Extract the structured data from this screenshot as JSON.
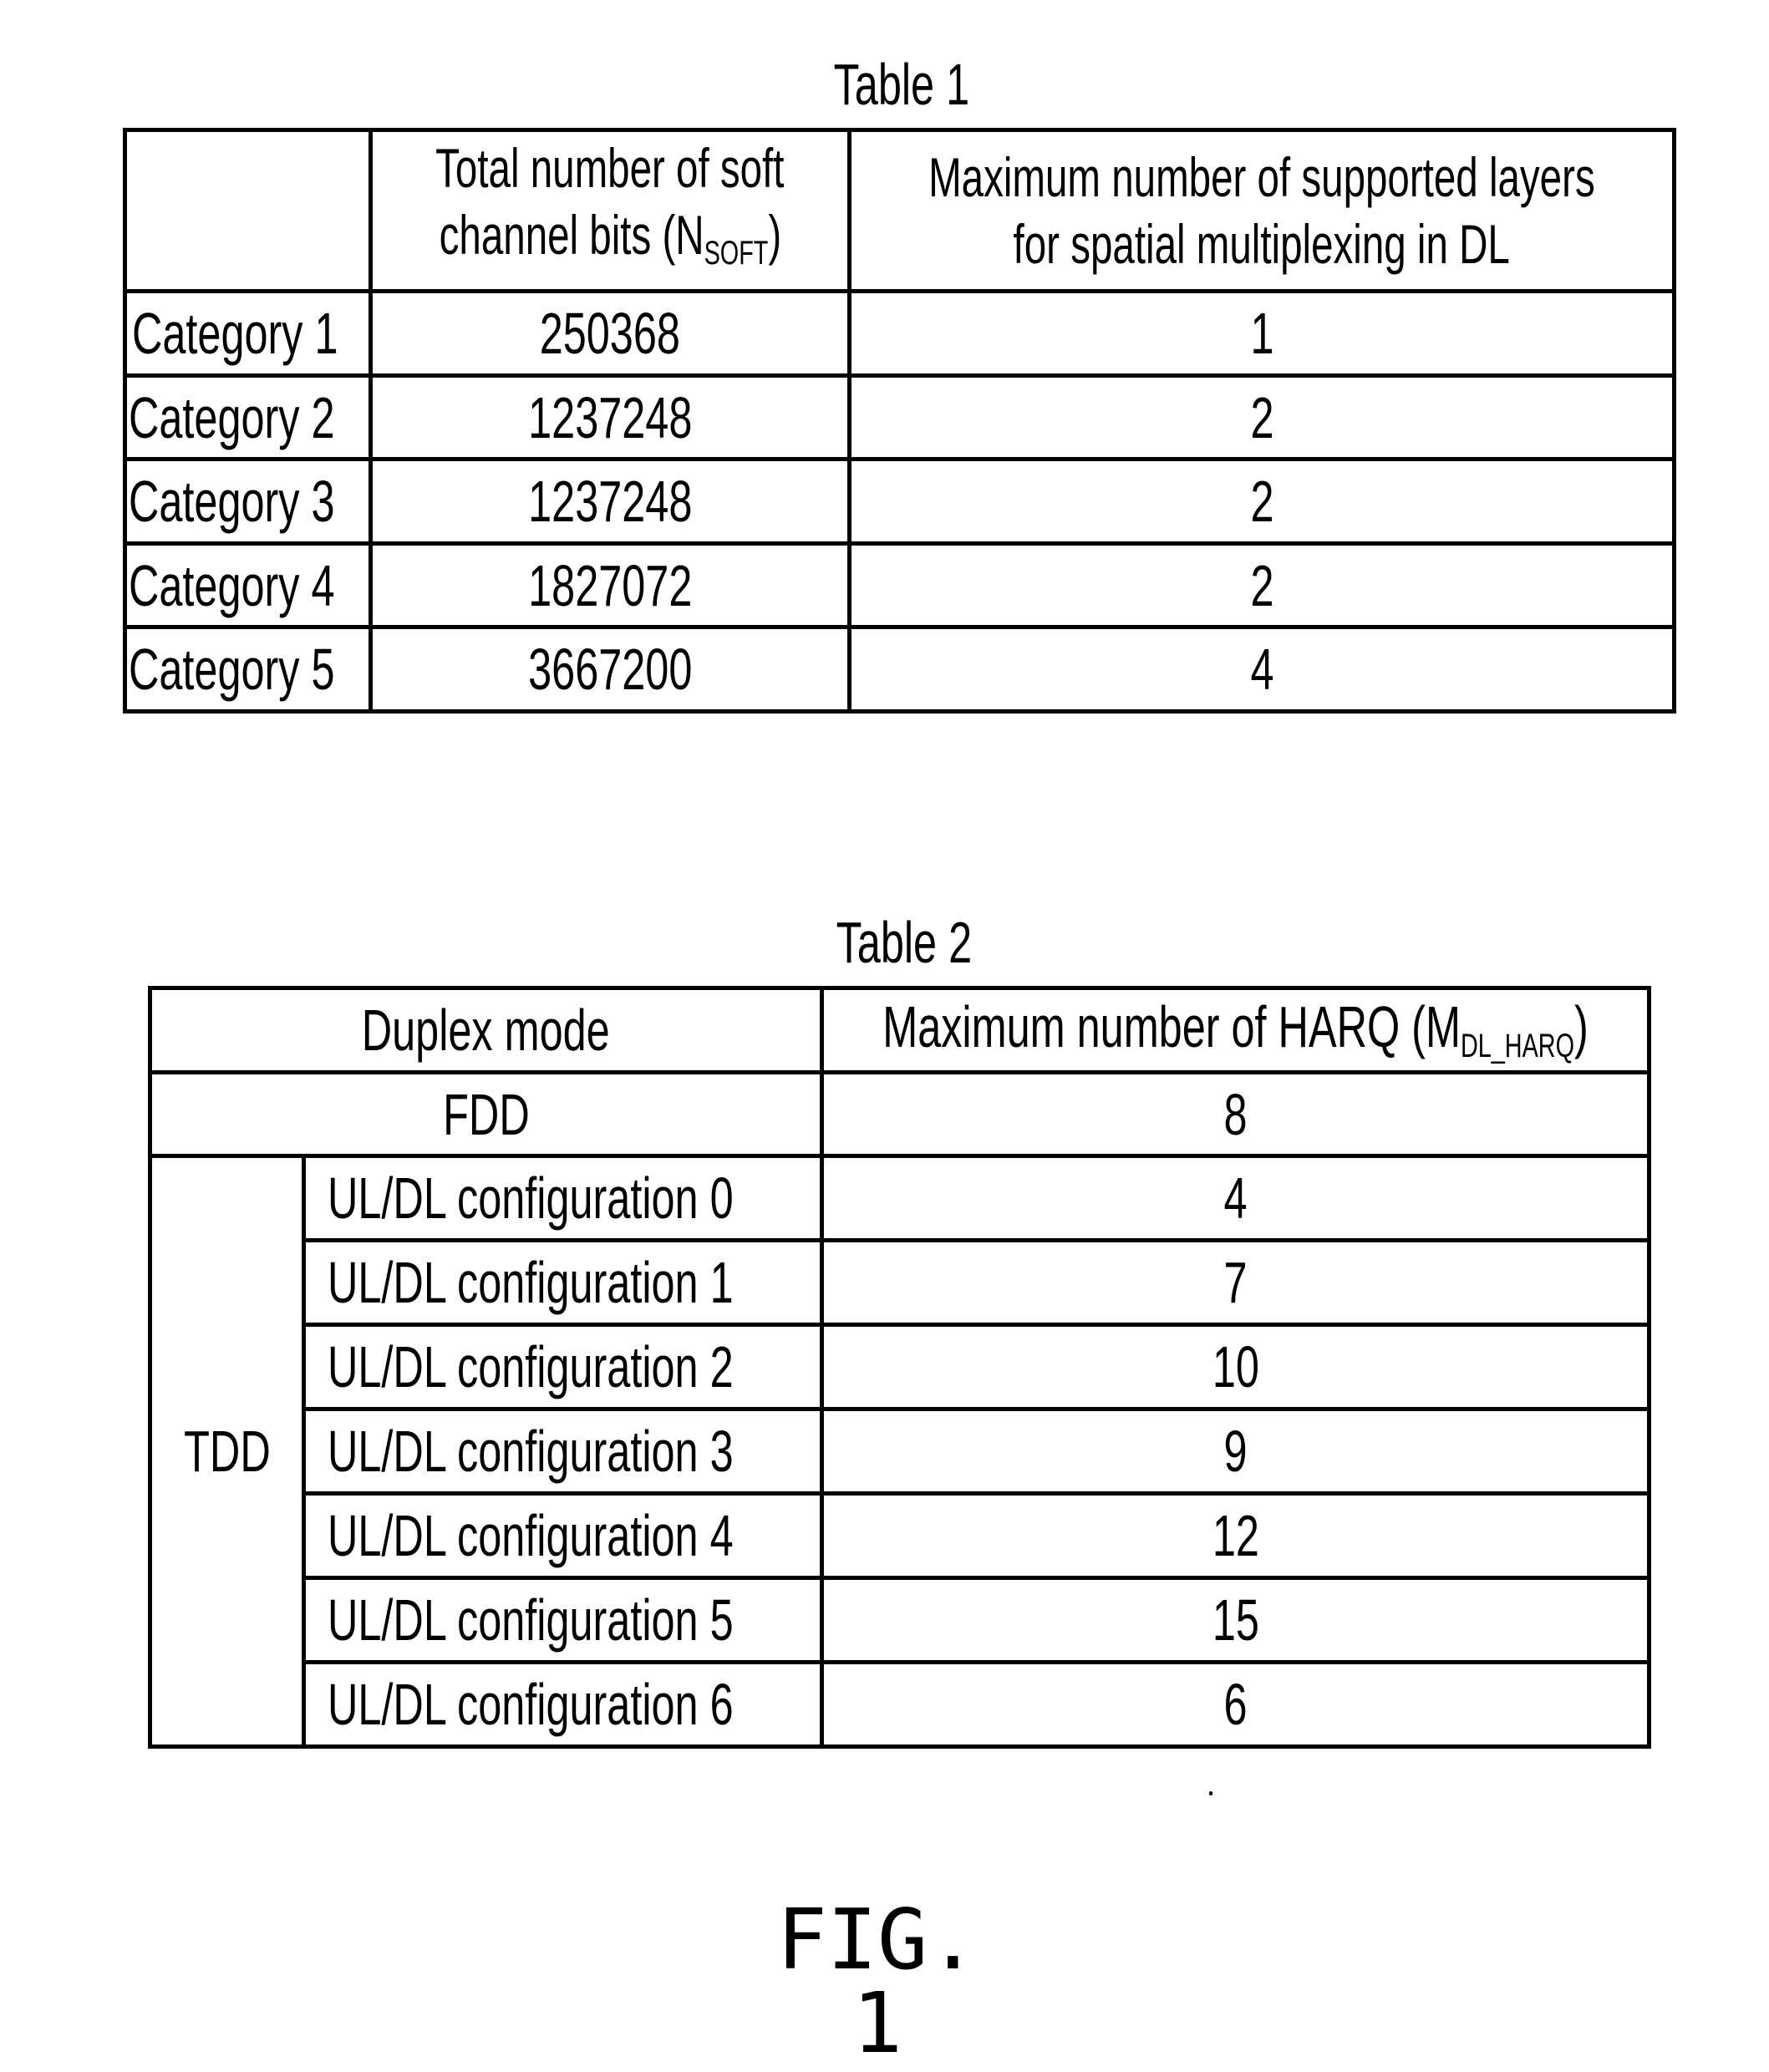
{
  "table1": {
    "title": "Table 1",
    "header": {
      "col0": "",
      "col1_line1": "Total number of soft",
      "col1_line2_prefix": "channel bits (N",
      "col1_subscript": "SOFT",
      "col1_line2_suffix": ")",
      "col2_line1": "Maximum number of supported layers",
      "col2_line2": "for spatial multiplexing in DL"
    },
    "rows": [
      {
        "category": "Category 1",
        "soft_bits": "250368",
        "layers": "1"
      },
      {
        "category": "Category 2",
        "soft_bits": "1237248",
        "layers": "2"
      },
      {
        "category": "Category 3",
        "soft_bits": "1237248",
        "layers": "2"
      },
      {
        "category": "Category 4",
        "soft_bits": "1827072",
        "layers": "2"
      },
      {
        "category": "Category 5",
        "soft_bits": "3667200",
        "layers": "4"
      }
    ]
  },
  "table2": {
    "title": "Table 2",
    "header": {
      "col0": "Duplex mode",
      "col1_prefix": "Maximum number of HARQ (M",
      "col1_subscript": "DL_HARQ",
      "col1_suffix": ")"
    },
    "fdd": {
      "mode": "FDD",
      "value": "8"
    },
    "tdd": {
      "mode": "TDD",
      "rows": [
        {
          "config": "UL/DL configuration 0",
          "value": "4"
        },
        {
          "config": "UL/DL configuration 1",
          "value": "7"
        },
        {
          "config": "UL/DL configuration 2",
          "value": "10"
        },
        {
          "config": "UL/DL configuration 3",
          "value": "9"
        },
        {
          "config": "UL/DL configuration 4",
          "value": "12"
        },
        {
          "config": "UL/DL configuration 5",
          "value": "15"
        },
        {
          "config": "UL/DL configuration 6",
          "value": "6"
        }
      ]
    }
  },
  "figure_label": "FIG. 1"
}
